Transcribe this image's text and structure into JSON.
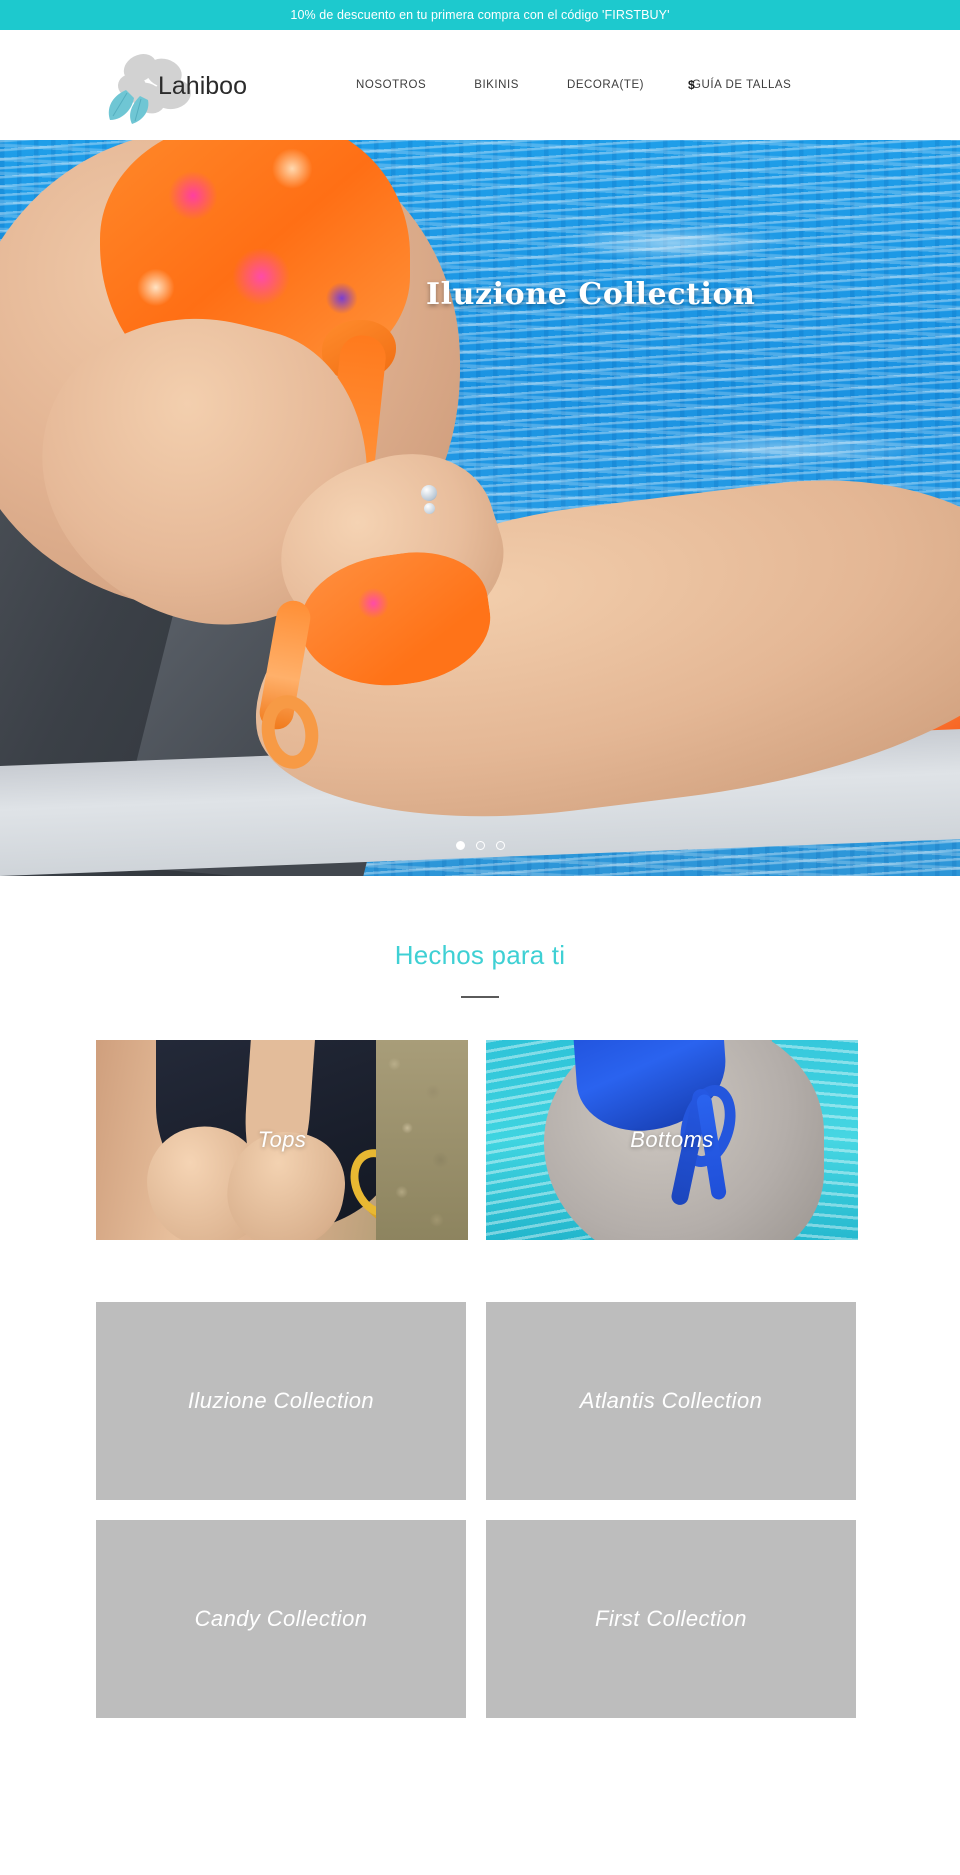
{
  "announcement": {
    "text": "10% de descuento en tu primera compra con el código 'FIRSTBUY'",
    "background": "#1dc9ce"
  },
  "header": {
    "logo_text": "Lahiboo",
    "nav": [
      {
        "label": "NOSOTROS"
      },
      {
        "label": "BIKINIS"
      },
      {
        "label": "DECORA(TE)"
      },
      {
        "label": "GUÍA DE TALLAS"
      }
    ],
    "currency_symbol": "$"
  },
  "hero": {
    "title": "Iluzione Collection",
    "slides": 3,
    "active_slide": 1
  },
  "featured": {
    "title": "Hechos para ti",
    "accent_color": "#3fd0d4",
    "categories": [
      {
        "label": "Tops"
      },
      {
        "label": "Bottoms"
      }
    ],
    "collections": [
      {
        "label": "Iluzione Collection"
      },
      {
        "label": "Atlantis Collection"
      },
      {
        "label": "Candy Collection"
      },
      {
        "label": "First Collection"
      }
    ],
    "placeholder_color": "#bdbdbd"
  }
}
